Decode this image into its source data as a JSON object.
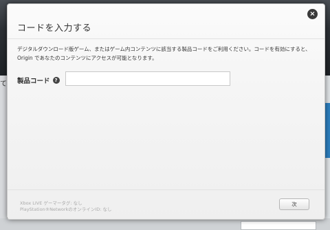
{
  "background": {
    "left_fragment": "て"
  },
  "dialog": {
    "title": "コードを入力する",
    "close_icon": "×",
    "description": "デジタルダウンロード版ゲーム、またはゲーム内コンテンツに該当する製品コードをご利用ください。コードを有効にすると、Origin であなたのコンテンツにアクセスが可能となります。",
    "code_label": "製品コード",
    "help_icon": "?",
    "code_value": "",
    "footer_xbox": "Xbox LIVE ゲーマータグ: なし",
    "footer_psn": "PlayStation®NetworkのオンラインID: なし",
    "next_label": "次"
  }
}
